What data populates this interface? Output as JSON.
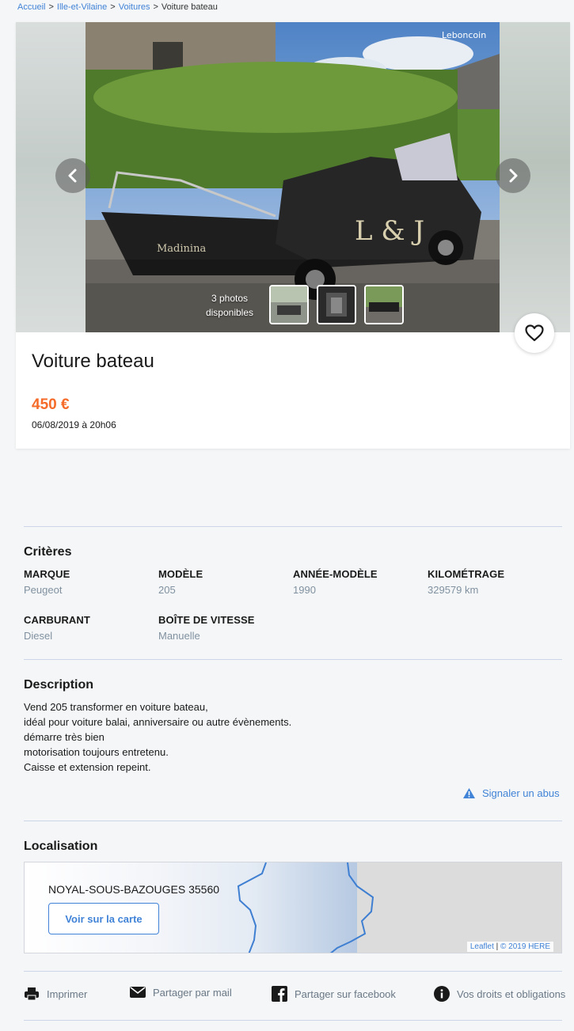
{
  "breadcrumb": {
    "home": "Accueil",
    "region": "Ille-et-Vilaine",
    "category": "Voitures",
    "current": "Voiture bateau",
    "separator": ">"
  },
  "gallery": {
    "watermark": "Leboncoin",
    "photos_count_line1": "3 photos",
    "photos_count_line2": "disponibles"
  },
  "ad": {
    "title": "Voiture bateau",
    "price": "450 €",
    "date": "06/08/2019 à 20h06"
  },
  "criteria": {
    "section_title": "Critères",
    "items": [
      {
        "label": "MARQUE",
        "value": "Peugeot"
      },
      {
        "label": "MODÈLE",
        "value": "205"
      },
      {
        "label": "ANNÉE-MODÈLE",
        "value": "1990"
      },
      {
        "label": "KILOMÉTRAGE",
        "value": "329579 km"
      },
      {
        "label": "CARBURANT",
        "value": "Diesel"
      },
      {
        "label": "BOÎTE DE VITESSE",
        "value": "Manuelle"
      }
    ]
  },
  "description": {
    "section_title": "Description",
    "lines": [
      "Vend 205 transformer en voiture bateau,",
      "idéal pour voiture balai, anniversaire ou autre évènements.",
      "démarre très bien",
      "motorisation toujours entretenu.",
      "Caisse et extension repeint."
    ],
    "report_label": "Signaler un abus"
  },
  "location": {
    "section_title": "Localisation",
    "address": "NOYAL-SOUS-BAZOUGES 35560",
    "map_button": "Voir sur la carte",
    "credit_leaflet": "Leaflet",
    "credit_sep": "|",
    "credit_here": "© 2019 HERE"
  },
  "actions": {
    "print": "Imprimer",
    "mail": "Partager par mail",
    "facebook": "Partager sur facebook",
    "rights": "Vos droits et obligations"
  },
  "colors": {
    "accent": "#f56b2a",
    "link": "#4183d7",
    "muted": "#8191a0",
    "divider": "#cdd5e8"
  }
}
